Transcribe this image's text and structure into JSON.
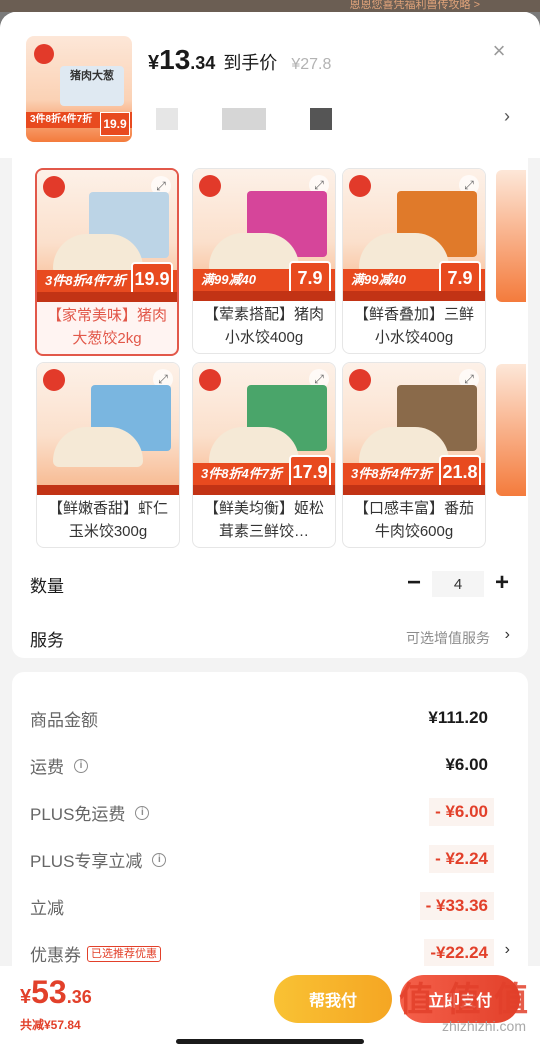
{
  "top_hint": "恩恩您喜凭福利兽传攻略 >",
  "header": {
    "price_symbol": "¥",
    "price_int": "13",
    "price_dec": ".34",
    "price_tag": "到手价",
    "original_price": "¥27.8",
    "close": "×",
    "spec_chevron": "›",
    "spec_swatches": [
      "#e6e6e6",
      "#d6d6d6",
      "#555555"
    ]
  },
  "thumb": {
    "title": "猪肉大葱",
    "promo": "3件8折4件7折",
    "price": "19.9"
  },
  "products": [
    {
      "name": "【家常美味】猪肉大葱饺2kg",
      "banner": "3件8折4件7折",
      "price": "19.9",
      "pack_color": "#bcd4e6",
      "selected": true
    },
    {
      "name": "【荤素搭配】猪肉小水饺400g",
      "banner": "满99减40",
      "price": "7.9",
      "pack_color": "#d6459a",
      "selected": false
    },
    {
      "name": "【鲜香叠加】三鲜小水饺400g",
      "banner": "满99减40",
      "price": "7.9",
      "pack_color": "#e07a2a",
      "selected": false
    },
    {
      "name": "【鲜嫩香甜】虾仁玉米饺300g",
      "banner": "",
      "price": "",
      "pack_color": "#7ab6e0",
      "selected": false
    },
    {
      "name": "【鲜美均衡】姬松茸素三鲜饺…",
      "banner": "3件8折4件7折",
      "price": "17.9",
      "pack_color": "#4aa56a",
      "selected": false
    },
    {
      "name": "【口感丰富】番茄牛肉饺600g",
      "banner": "3件8折4件7折",
      "price": "21.8",
      "pack_color": "#8a6a4a",
      "selected": false
    }
  ],
  "quantity": {
    "label": "数量",
    "minus": "−",
    "plus": "+",
    "value": "4"
  },
  "service": {
    "label": "服务",
    "value": "可选增值服务",
    "chevron": "›"
  },
  "fees": [
    {
      "label": "商品金额",
      "value": "¥111.20",
      "red": false,
      "info": false
    },
    {
      "label": "运费",
      "value": "¥6.00",
      "red": false,
      "info": true
    },
    {
      "label": "PLUS免运费",
      "value": "- ¥6.00",
      "red": true,
      "info": true
    },
    {
      "label": "PLUS专享立减",
      "value": "- ¥2.24",
      "red": true,
      "info": true
    },
    {
      "label": "立减",
      "value": "- ¥33.36",
      "red": true,
      "info": false
    },
    {
      "label": "优惠券",
      "value": "-¥22.24",
      "red": true,
      "info": false,
      "tag": "已选推荐优惠",
      "chevron": "›"
    }
  ],
  "info_glyph": "i",
  "bottom": {
    "total_sym": "¥",
    "total_int": "53",
    "total_dec": ".36",
    "saved": "共减¥57.84",
    "help_pay": "帮我付",
    "pay": "立即支付",
    "watermark": "值 值 值",
    "watermark_url": "zhizhizhi.com"
  }
}
